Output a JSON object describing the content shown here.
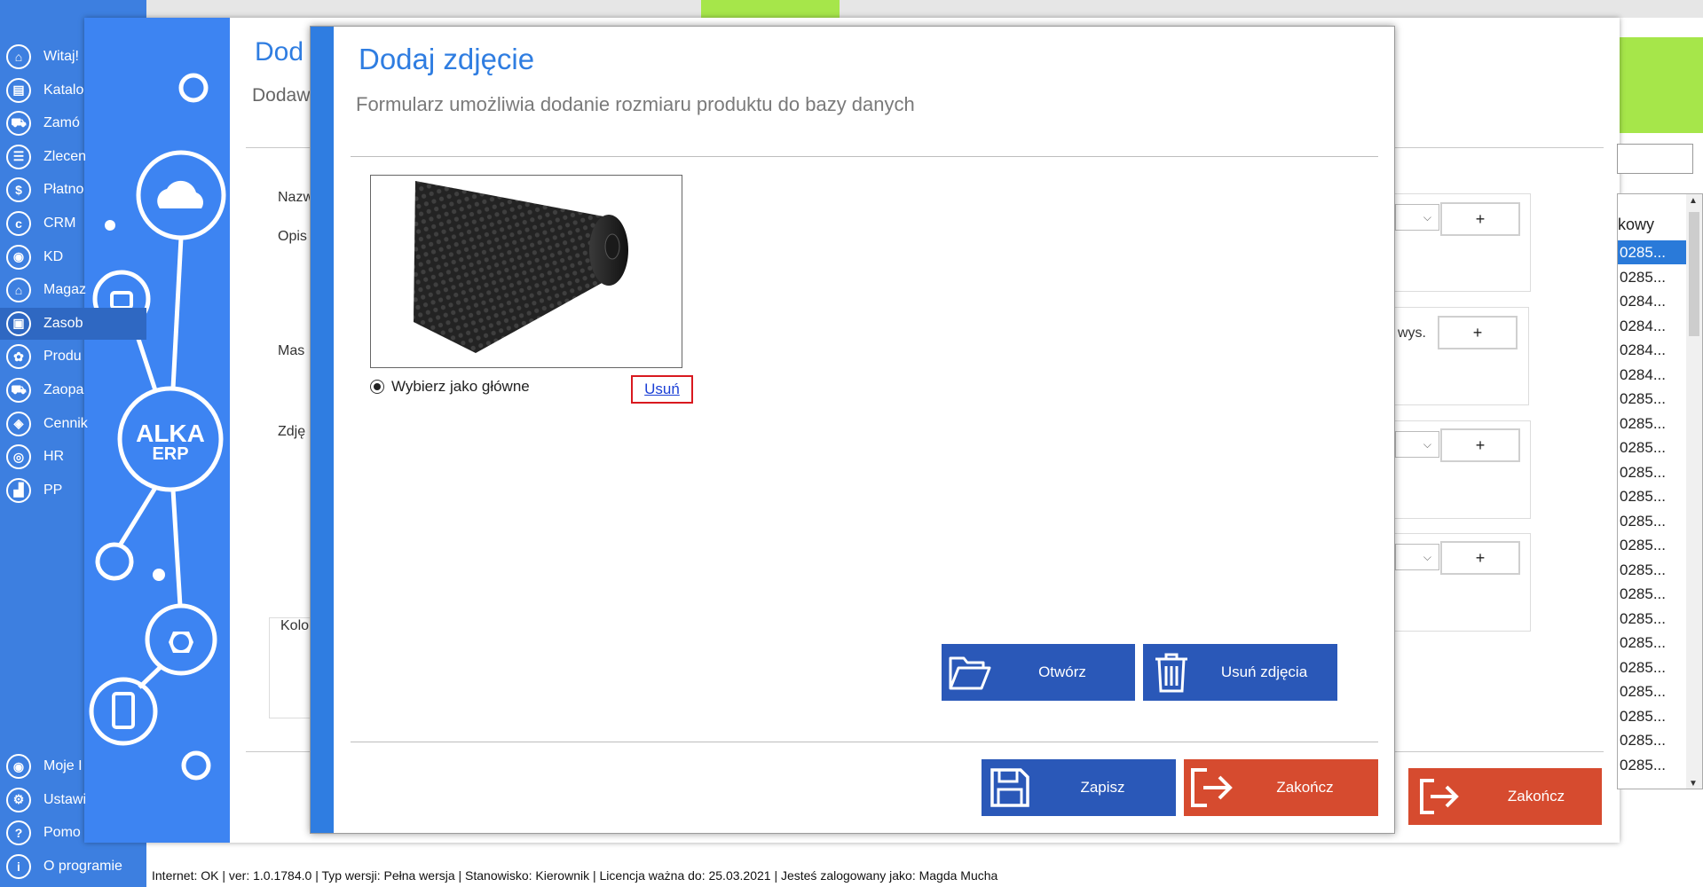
{
  "sidebar": {
    "items": [
      {
        "label": "Witaj!",
        "icon": "home-icon",
        "glyph": "⌂"
      },
      {
        "label": "Katalo",
        "icon": "catalog-icon",
        "glyph": "▤"
      },
      {
        "label": "Zamó",
        "icon": "cart-icon",
        "glyph": "⛟"
      },
      {
        "label": "Zlecen",
        "icon": "list-icon",
        "glyph": "☰"
      },
      {
        "label": "Płatno",
        "icon": "dollar-icon",
        "glyph": "$"
      },
      {
        "label": "CRM",
        "icon": "crm-icon",
        "glyph": "c"
      },
      {
        "label": "KD",
        "icon": "person-icon",
        "glyph": "◉"
      },
      {
        "label": "Magaz",
        "icon": "warehouse-icon",
        "glyph": "⌂"
      },
      {
        "label": "Zasob",
        "icon": "resources-icon",
        "glyph": "▣"
      },
      {
        "label": "Produ",
        "icon": "production-icon",
        "glyph": "✿"
      },
      {
        "label": "Zaopa",
        "icon": "supply-icon",
        "glyph": "⛟"
      },
      {
        "label": "Cennik",
        "icon": "tag-icon",
        "glyph": "◈"
      },
      {
        "label": "HR",
        "icon": "hr-icon",
        "glyph": "◎"
      },
      {
        "label": "PP",
        "icon": "factory-icon",
        "glyph": "▟"
      }
    ],
    "bottom_items": [
      {
        "label": "Moje I",
        "icon": "user-icon",
        "glyph": "◉"
      },
      {
        "label": "Ustawi",
        "icon": "settings-icon",
        "glyph": "⚙"
      },
      {
        "label": "Pomo",
        "icon": "help-icon",
        "glyph": "?"
      },
      {
        "label": "O programie",
        "icon": "info-icon",
        "glyph": "i"
      }
    ]
  },
  "main": {
    "title": "Dod",
    "subtitle": "Dodaw",
    "labels": [
      "Nazw",
      "Opis",
      "Mas",
      "Zdję",
      "Kolo"
    ],
    "wys_label": "wys.",
    "plus": "+",
    "select_arrow": "⌵",
    "zakoncz_label": "Zakończ"
  },
  "right_list": {
    "header": "kowy",
    "rows": [
      "0285...",
      "0285...",
      "0284...",
      "0284...",
      "0284...",
      "0284...",
      "0285...",
      "0285...",
      "0285...",
      "0285...",
      "0285...",
      "0285...",
      "0285...",
      "0285...",
      "0285...",
      "0285...",
      "0285...",
      "0285...",
      "0285...",
      "0285...",
      "0285...",
      "0285..."
    ],
    "selected_index": 0
  },
  "statusbar": {
    "text": "Internet: OK  |  ver: 1.0.1784.0  |  Typ wersji: Pełna wersja  |  Stanowisko: Kierownik  |  Licencja ważna do: 25.03.2021  |  Jesteś zalogowany jako: Magda Mucha"
  },
  "modal": {
    "title": "Dodaj zdjęcie",
    "subtitle": "Formularz umożliwia dodanie rozmiaru produktu do bazy danych",
    "radio_label": "Wybierz jako główne",
    "delete_link": "Usuń",
    "open_button": "Otwórz",
    "delete_photos_button": "Usuń zdjęcia",
    "save_button": "Zapisz",
    "close_button": "Zakończ"
  },
  "colors": {
    "sidebar": "#3d7fe0",
    "accent_blue": "#2f7de1",
    "button_blue": "#2a58b8",
    "button_red": "#d64b2f",
    "green": "#a6e64a",
    "highlight_red": "#d9191f"
  },
  "logo": {
    "line1": "ALKA",
    "line2": "ERP"
  }
}
